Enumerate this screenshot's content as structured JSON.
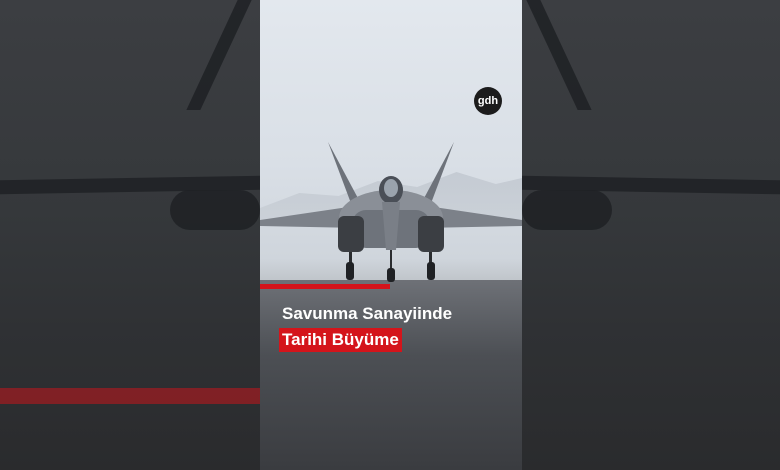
{
  "video": {
    "logo_text": "gdh",
    "headline_line1": "Savunma Sanayiinde",
    "headline_line2": "Tarihi Büyüme"
  },
  "colors": {
    "accent_red": "#d4141b",
    "sky": "#dde3ea",
    "runway": "#4c4f54"
  },
  "icons": [
    "aircraft-image"
  ]
}
